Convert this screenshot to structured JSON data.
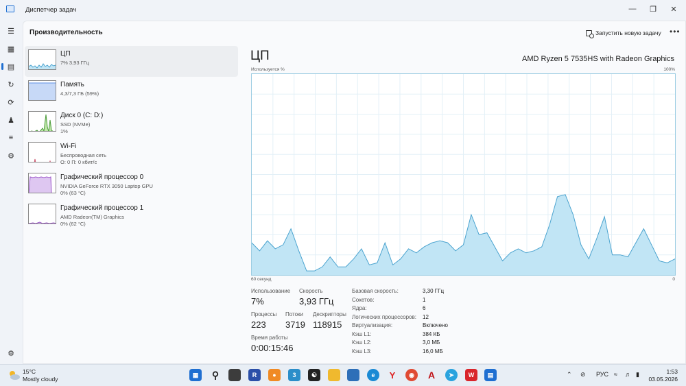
{
  "window": {
    "title": "Диспетчер задач"
  },
  "header": {
    "title": "Производительность",
    "run_task": "Запустить новую задачу"
  },
  "devices": [
    {
      "name": "ЦП",
      "line1": "7% 3,93 ГГц",
      "line2": ""
    },
    {
      "name": "Память",
      "line1": "4,3/7,3 ГБ (59%)",
      "line2": ""
    },
    {
      "name": "Диск 0 (C: D:)",
      "line1": "SSD (NVMe)",
      "line2": "1%"
    },
    {
      "name": "Wi-Fi",
      "line1": "Беспроводная сеть",
      "line2": "О: 0 П: 0 кбит/с"
    },
    {
      "name": "Графический процессор 0",
      "line1": "NVIDIA GeForce RTX 3050 Laptop GPU",
      "line2": "0% (63 °C)"
    },
    {
      "name": "Графический процессор 1",
      "line1": "AMD Radeon(TM) Graphics",
      "line2": "0% (62 °C)"
    }
  ],
  "cpu": {
    "title": "ЦП",
    "model": "AMD Ryzen 5 7535HS with Radeon Graphics",
    "usage_label": "Используется %",
    "max_label": "100%",
    "time_label": "60 секунд",
    "min_label": "0",
    "graph_color": "#c1e5f5",
    "graph_line": "#4aa3cf",
    "usage_history": [
      16,
      12,
      17,
      13,
      15,
      23,
      12,
      2,
      2,
      4,
      9,
      4,
      4,
      8,
      13,
      5,
      6,
      16,
      5,
      8,
      13,
      11,
      14,
      16,
      17,
      16,
      12,
      15,
      30,
      20,
      21,
      14,
      7,
      11,
      13,
      11,
      12,
      14,
      25,
      39,
      40,
      30,
      15,
      8,
      18,
      29,
      10,
      10,
      9,
      16,
      23,
      15,
      7,
      6,
      8
    ],
    "stats": {
      "usage_lbl": "Использование",
      "usage": "7%",
      "speed_lbl": "Скорость",
      "speed": "3,93 ГГц",
      "proc_lbl": "Процессы",
      "proc": "223",
      "threads_lbl": "Потоки",
      "threads": "3719",
      "handles_lbl": "Дескрипторы",
      "handles": "118915",
      "uptime_lbl": "Время работы",
      "uptime": "0:00:15:46"
    },
    "specs": [
      {
        "k": "Базовая скорость:",
        "v": "3,30 ГГц"
      },
      {
        "k": "Сокетов:",
        "v": "1"
      },
      {
        "k": "Ядра:",
        "v": "6"
      },
      {
        "k": "Логических процессоров:",
        "v": "12"
      },
      {
        "k": "Виртуализация:",
        "v": "Включено"
      },
      {
        "k": "Кэш L1:",
        "v": "384 КБ"
      },
      {
        "k": "Кэш L2:",
        "v": "3,0 МБ"
      },
      {
        "k": "Кэш L3:",
        "v": "16,0 МБ"
      }
    ]
  },
  "taskbar": {
    "temp": "15°C",
    "condition": "Mostly cloudy",
    "lang": "РУС",
    "time": "1:53",
    "date": "03.05.2026"
  }
}
